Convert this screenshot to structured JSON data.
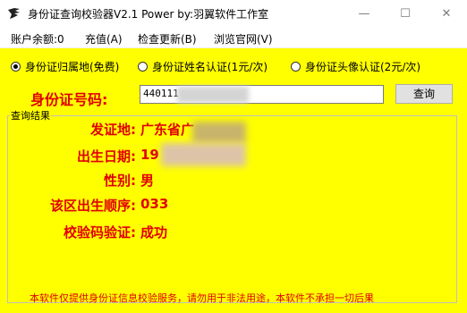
{
  "window": {
    "title": "身份证查询校验器V2.1 Power by:羽翼软件工作室",
    "controls": {
      "minimize": "—",
      "maximize": "☐",
      "close": "✕"
    }
  },
  "menu": {
    "items": [
      {
        "label": "账户余额:0"
      },
      {
        "label": "充值(A)"
      },
      {
        "label": "检查更新(B)"
      },
      {
        "label": "浏览官网(V)"
      }
    ]
  },
  "options": [
    {
      "label": "身份证归属地(免费)",
      "checked": true
    },
    {
      "label": "身份证姓名认证(1元/次)",
      "checked": false
    },
    {
      "label": "身份证头像认证(2元/次)",
      "checked": false
    }
  ],
  "query": {
    "label": "身份证号码:",
    "value": "440111",
    "button": "查询"
  },
  "results": {
    "group_title": "查询结果",
    "rows": [
      {
        "label": "发证地:",
        "value": "广东省广"
      },
      {
        "label": "出生日期:",
        "value": "19"
      },
      {
        "label": "性别:",
        "value": "男"
      },
      {
        "label": "该区出生顺序:",
        "value": "033"
      },
      {
        "label": "校验码验证:",
        "value": "成功"
      }
    ]
  },
  "footer": "本软件仅提供身份证信息校验服务，请勿用于非法用途，本软件不承担一切后果",
  "colors": {
    "background": "#ffff00",
    "accent": "#e00000"
  }
}
